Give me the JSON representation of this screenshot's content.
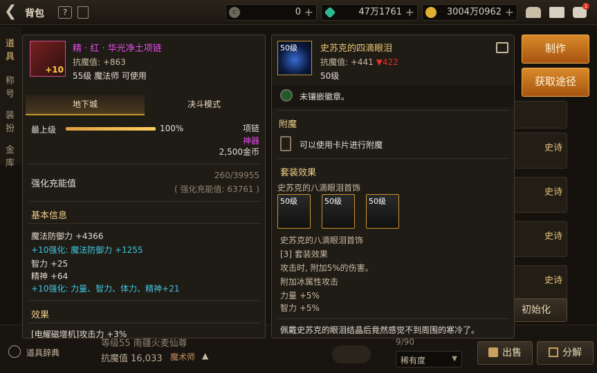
{
  "topbar": {
    "title": "背包",
    "currencies": [
      {
        "icon": "coupon-icon",
        "value": "0"
      },
      {
        "icon": "gem-icon",
        "value": "47万1761"
      },
      {
        "icon": "gold-coin-icon",
        "value": "3004万0962"
      }
    ],
    "notify_badge": "1"
  },
  "side": {
    "tabs": [
      "道具",
      "称号",
      "装扮",
      "金库"
    ],
    "dictionary_label": "道具辞典"
  },
  "background": {
    "rarity_labels": [
      "史诗",
      "史诗",
      "史诗",
      "史诗",
      "史诗"
    ],
    "reset_label": "初始化",
    "level_text": "等级55 南疆火麦仙尊",
    "resistance_text": "抗魔值 16,033",
    "job_text": "魔术师",
    "page": "9/90",
    "sort_label": "稀有度",
    "sell_label": "出售",
    "decompose_label": "分解"
  },
  "left_panel": {
    "item_name": "精 · 红 · 华光净土项链",
    "item_upgrade_badge": "+10",
    "resistance": "抗魔值: +863",
    "requirement": "55级 魔法师 可使用",
    "tabs": [
      "地下城",
      "决斗模式"
    ],
    "max_level_label": "最上级",
    "max_level_percent": "100%",
    "max_level_fraction": 1.0,
    "slot_type": "项链",
    "rarity": "神器",
    "price": "2,500金币",
    "charge_label": "强化充能值",
    "charge_value": "260/39955",
    "charge_total": "( 强化充能值: 63761 )",
    "basic_info_header": "基本信息",
    "stats": [
      {
        "text": "魔法防御力 +4366",
        "color": "white"
      },
      {
        "text": "+10强化: 魔法防御力 +1255",
        "color": "cyan"
      },
      {
        "text": "智力 +25",
        "color": "white"
      },
      {
        "text": "精神 +64",
        "color": "white"
      },
      {
        "text": "+10强化: 力量、智力、体力、精神+21",
        "color": "cyan"
      }
    ],
    "effect_header": "效果",
    "effect_partial": "[电耀磁增机]攻击力 +3%"
  },
  "right_panel": {
    "item_name": "史苏克的四滴眼泪",
    "icon_level": "50级",
    "resistance": "抗魔值: +441",
    "resistance_diff": "▼422",
    "level": "50级",
    "emblem_text": "未镶嵌徽章。",
    "enchant_header": "附魔",
    "enchant_text": "可以使用卡片进行附魔",
    "set_header": "套装效果",
    "set_name": "史苏克的八滴眼泪首饰",
    "set_slots": [
      "50级",
      "50级",
      "50级"
    ],
    "set_name2": "史苏克的八滴眼泪首饰",
    "set_lines": [
      "[3] 套装效果",
      "攻击时, 附加5%的伤害。",
      "附加冰属性攻击",
      "力量 +5%",
      "智力 +5%"
    ],
    "flavor": "佩戴史苏克的眼泪结晶后竟然感觉不到周围的寒冷了。"
  },
  "actions": {
    "craft_label": "制作",
    "obtain_label": "获取途径"
  }
}
